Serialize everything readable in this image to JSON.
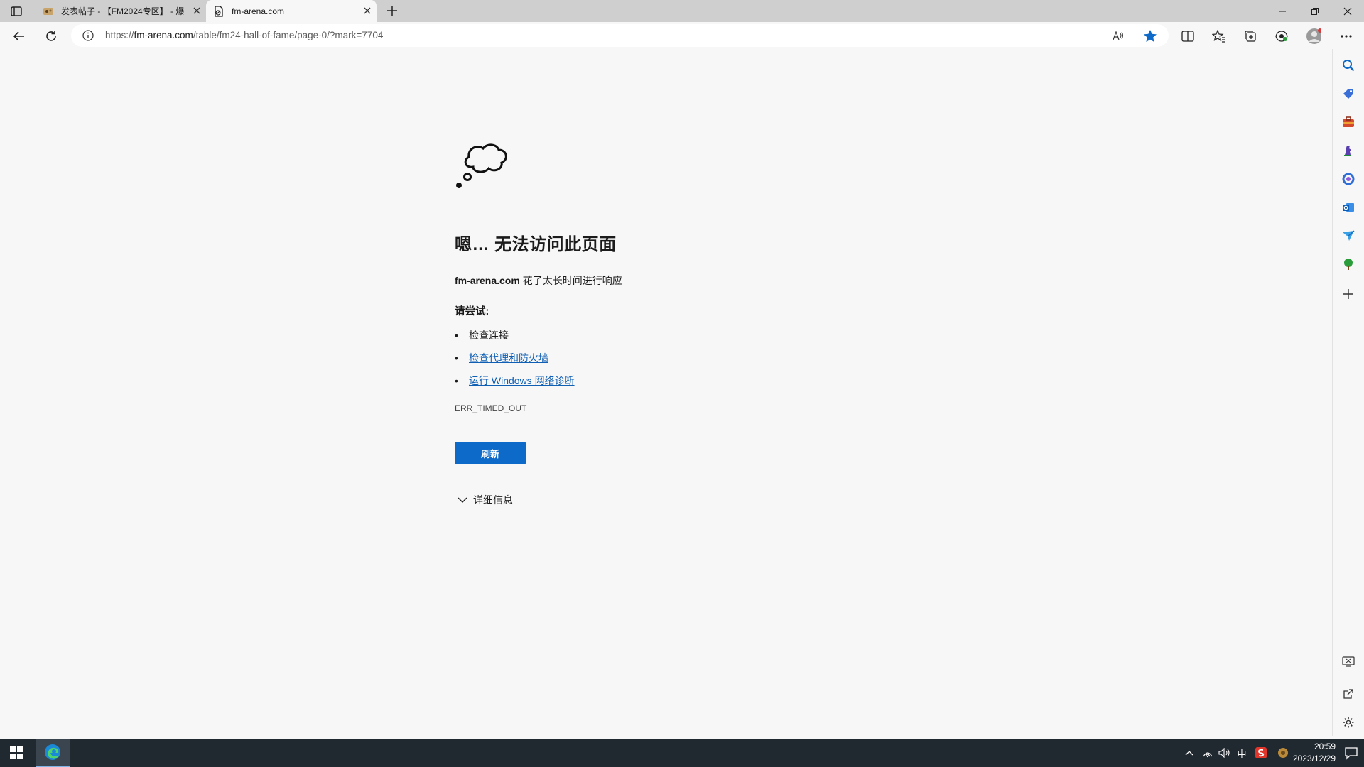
{
  "browser": {
    "tabs": [
      {
        "title": "发表帖子 - 【FM2024专区】 - 爆",
        "active": false
      },
      {
        "title": "fm-arena.com",
        "active": true
      }
    ],
    "address": {
      "prefix": "https://",
      "host": "fm-arena.com",
      "path": "/table/fm24-hall-of-fame/page-0/?mark=7704"
    }
  },
  "error_page": {
    "heading": "嗯… 无法访问此页面",
    "host": "fm-arena.com",
    "message": " 花了太长时间进行响应",
    "try_label": "请尝试:",
    "suggestions": [
      {
        "text": "检查连接",
        "link": false
      },
      {
        "text": "检查代理和防火墙",
        "link": true
      },
      {
        "text": "运行 Windows 网络诊断",
        "link": true
      }
    ],
    "error_code": "ERR_TIMED_OUT",
    "refresh_label": "刷新",
    "details_label": "详细信息"
  },
  "taskbar": {
    "ime_label": "中",
    "time": "20:59",
    "date": "2023/12/29"
  },
  "colors": {
    "accent": "#0d6ac8",
    "link": "#0f5fb4",
    "taskbar": "#202830"
  }
}
